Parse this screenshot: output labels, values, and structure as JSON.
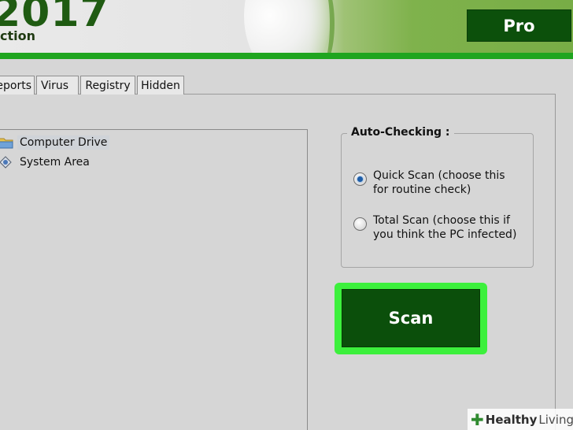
{
  "header": {
    "year": "2017",
    "subtitle": "ction",
    "badge": "Pro",
    "accent_color": "#1fa51f",
    "badge_color": "#0c500b"
  },
  "tabs": [
    {
      "label": "eports"
    },
    {
      "label": "Virus"
    },
    {
      "label": "Registry"
    },
    {
      "label": "Hidden"
    }
  ],
  "tree": {
    "items": [
      {
        "label": "Computer Drive",
        "icon": "folder-drive-icon",
        "selected": true
      },
      {
        "label": "System Area",
        "icon": "system-area-icon",
        "selected": false
      }
    ]
  },
  "auto_checking": {
    "title": "Auto-Checking :",
    "options": [
      {
        "label": "Quick Scan (choose this for routine check)",
        "checked": true
      },
      {
        "label": "Total Scan (choose this if you think the PC infected)",
        "checked": false
      }
    ]
  },
  "scan": {
    "label": "Scan",
    "highlight_color": "#3cf03c",
    "button_color": "#0b4f0b"
  },
  "watermark": {
    "healthy": "Healthy",
    "living": "Living"
  }
}
